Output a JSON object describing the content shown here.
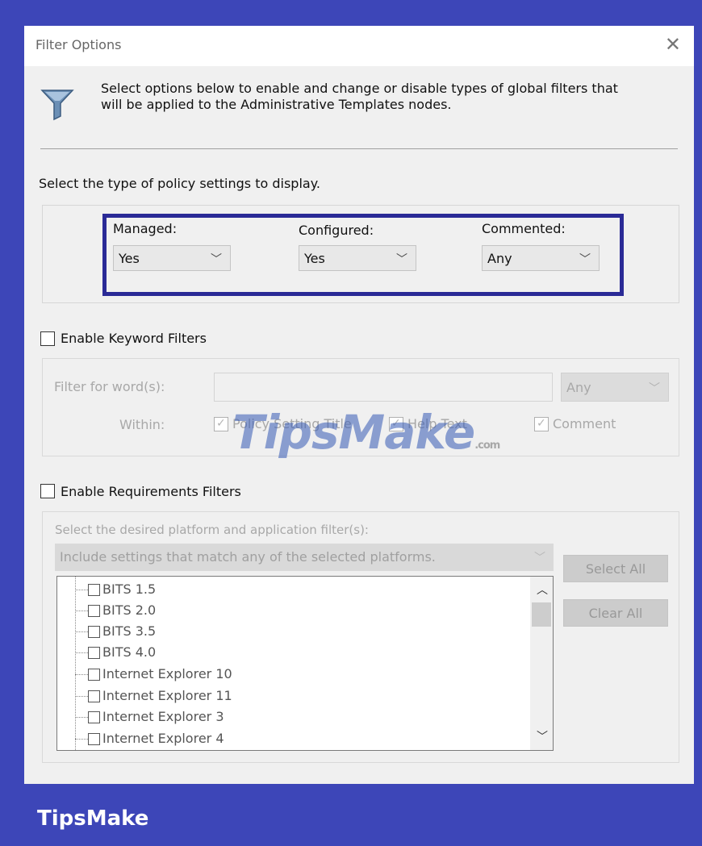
{
  "window": {
    "title": "Filter Options",
    "close_glyph": "✕"
  },
  "intro": {
    "icon": "filter-funnel-icon",
    "text": "Select options below to enable and change or disable types of global filters that will be applied to the Administrative Templates nodes."
  },
  "policy_type": {
    "label": "Select the type of policy settings to display.",
    "managed": {
      "label": "Managed:",
      "value": "Yes"
    },
    "configured": {
      "label": "Configured:",
      "value": "Yes"
    },
    "commented": {
      "label": "Commented:",
      "value": "Any"
    }
  },
  "keyword_filters": {
    "checkbox_label": "Enable Keyword Filters",
    "checked": false,
    "filter_label": "Filter for word(s):",
    "filter_value": "",
    "match_value": "Any",
    "within_label": "Within:",
    "within_options": [
      "Policy Setting Title",
      "Help Text",
      "Comment"
    ]
  },
  "requirements_filters": {
    "checkbox_label": "Enable Requirements Filters",
    "checked": false,
    "platform_label": "Select the desired platform and application filter(s):",
    "match_mode": "Include settings that match any of the selected platforms.",
    "select_all_label": "Select All",
    "clear_all_label": "Clear All",
    "platforms": [
      "BITS 1.5",
      "BITS 2.0",
      "BITS 3.5",
      "BITS 4.0",
      "Internet Explorer 10",
      "Internet Explorer 11",
      "Internet Explorer 3",
      "Internet Explorer 4"
    ]
  },
  "watermark": {
    "text": "TipsMake",
    "suffix": ".com"
  },
  "brand": {
    "text": "TipsMake"
  },
  "colors": {
    "frame": "#3d46b8",
    "highlight_border": "#2a2a96",
    "dialog_bg": "#f0f0f0"
  }
}
